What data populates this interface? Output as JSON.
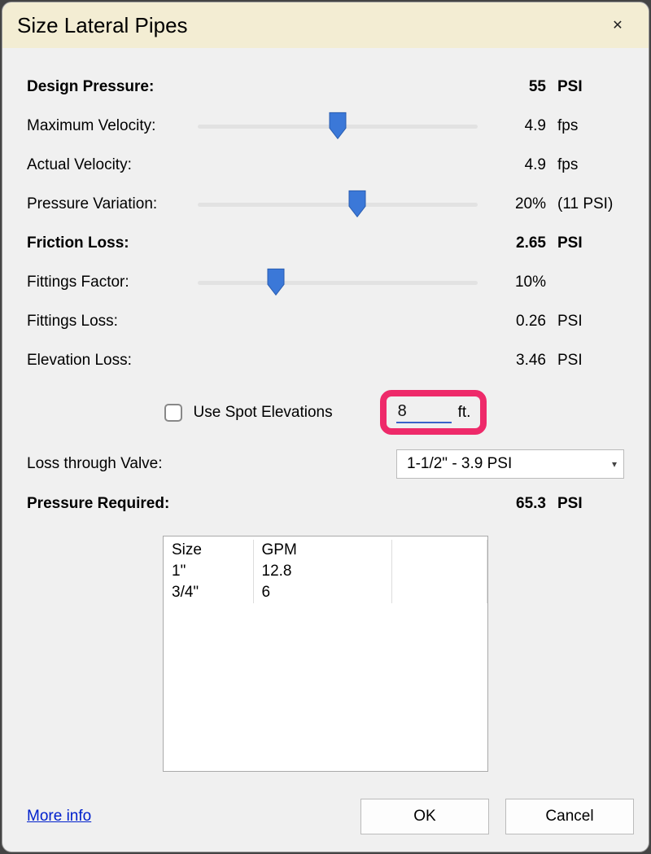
{
  "dialog": {
    "title": "Size Lateral Pipes",
    "close_icon": "✕"
  },
  "rows": {
    "design_pressure": {
      "label": "Design Pressure:",
      "value": "55",
      "unit": "PSI"
    },
    "max_velocity": {
      "label": "Maximum Velocity:",
      "value": "4.9",
      "unit": "fps",
      "slider_pct": 50
    },
    "actual_velocity": {
      "label": "Actual Velocity:",
      "value": "4.9",
      "unit": "fps"
    },
    "pressure_var": {
      "label": "Pressure Variation:",
      "value": "20%",
      "unit": "(11 PSI)",
      "slider_pct": 57
    },
    "friction": {
      "label": "Friction Loss:",
      "value": "2.65",
      "unit": "PSI"
    },
    "fittings_factor": {
      "label": "Fittings Factor:",
      "value": "10%",
      "unit": "",
      "slider_pct": 28
    },
    "fittings_loss": {
      "label": "Fittings Loss:",
      "value": "0.26",
      "unit": "PSI"
    },
    "elevation_loss": {
      "label": "Elevation Loss:",
      "value": "3.46",
      "unit": "PSI"
    }
  },
  "spot": {
    "checkbox_label": "Use Spot Elevations",
    "value": "8",
    "unit": "ft."
  },
  "valve": {
    "label": "Loss through Valve:",
    "selected": "1-1/2\" - 3.9 PSI"
  },
  "pressure_required": {
    "label": "Pressure Required:",
    "value": "65.3",
    "unit": "PSI"
  },
  "table": {
    "headers": [
      "Size",
      "GPM"
    ],
    "rows": [
      [
        "1\"",
        "12.8"
      ],
      [
        "3/4\"",
        "6"
      ]
    ]
  },
  "footer": {
    "more_info": "More info",
    "ok": "OK",
    "cancel": "Cancel"
  }
}
